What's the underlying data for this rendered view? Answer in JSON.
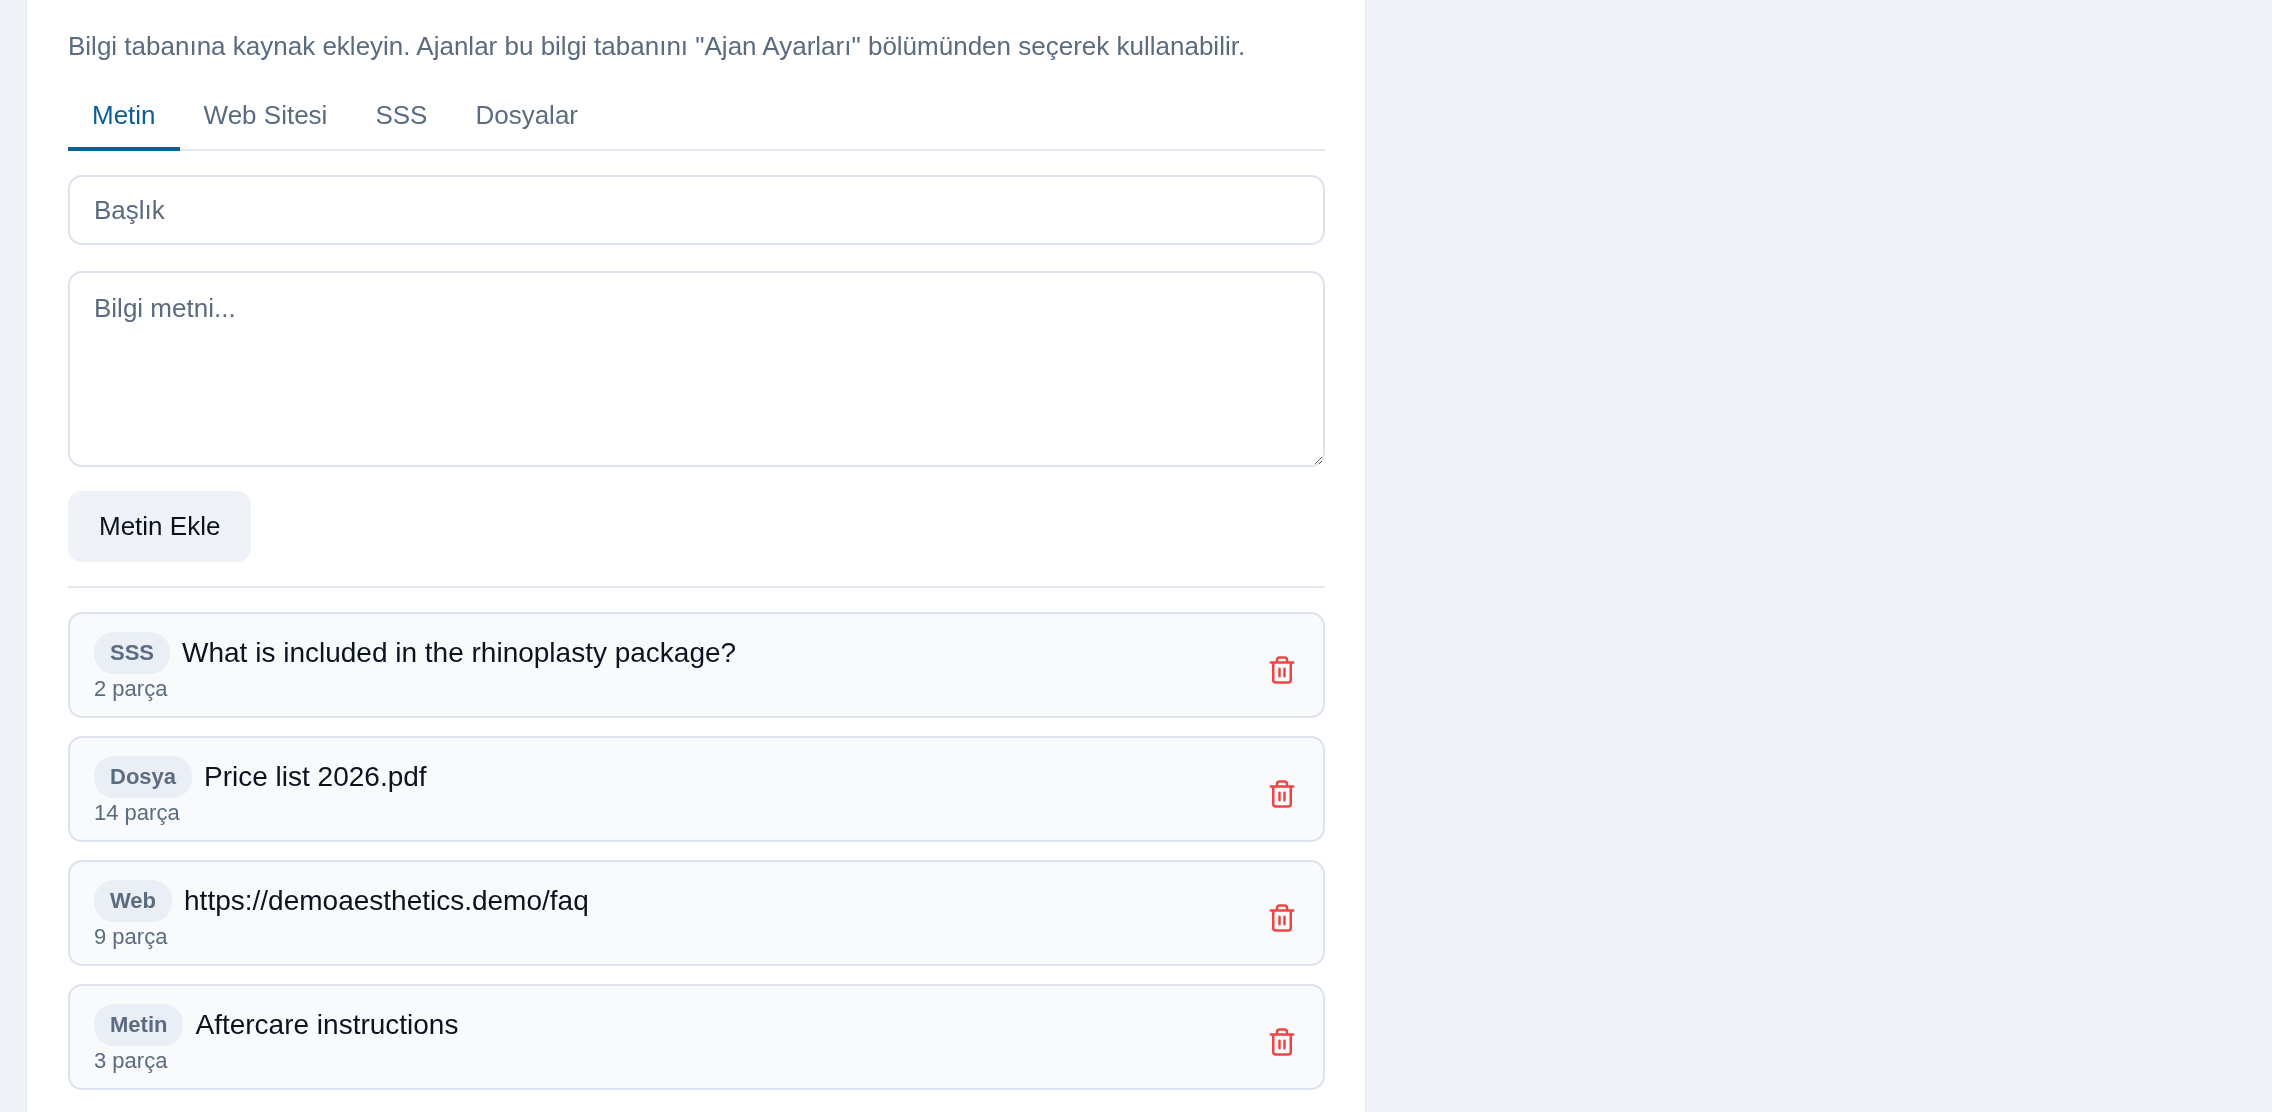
{
  "description": "Bilgi tabanına kaynak ekleyin. Ajanlar bu bilgi tabanını \"Ajan Ayarları\" bölümünden seçerek kullanabilir.",
  "tabs": [
    {
      "label": "Metin",
      "selected": true
    },
    {
      "label": "Web Sitesi",
      "selected": false
    },
    {
      "label": "SSS",
      "selected": false
    },
    {
      "label": "Dosyalar",
      "selected": false
    }
  ],
  "title_field": {
    "placeholder": "Başlık"
  },
  "text_field": {
    "placeholder": "Bilgi metni..."
  },
  "add_button": "Metin Ekle",
  "sources": [
    {
      "badge": "SSS",
      "title": "What is included in the rhinoplasty package?",
      "chunks": "2 parça"
    },
    {
      "badge": "Dosya",
      "title": "Price list 2026.pdf",
      "chunks": "14 parça"
    },
    {
      "badge": "Web",
      "title": "https://demoaesthetics.demo/faq",
      "chunks": "9 parça"
    },
    {
      "badge": "Metin",
      "title": "Aftercare instructions",
      "chunks": "3 parça"
    }
  ]
}
